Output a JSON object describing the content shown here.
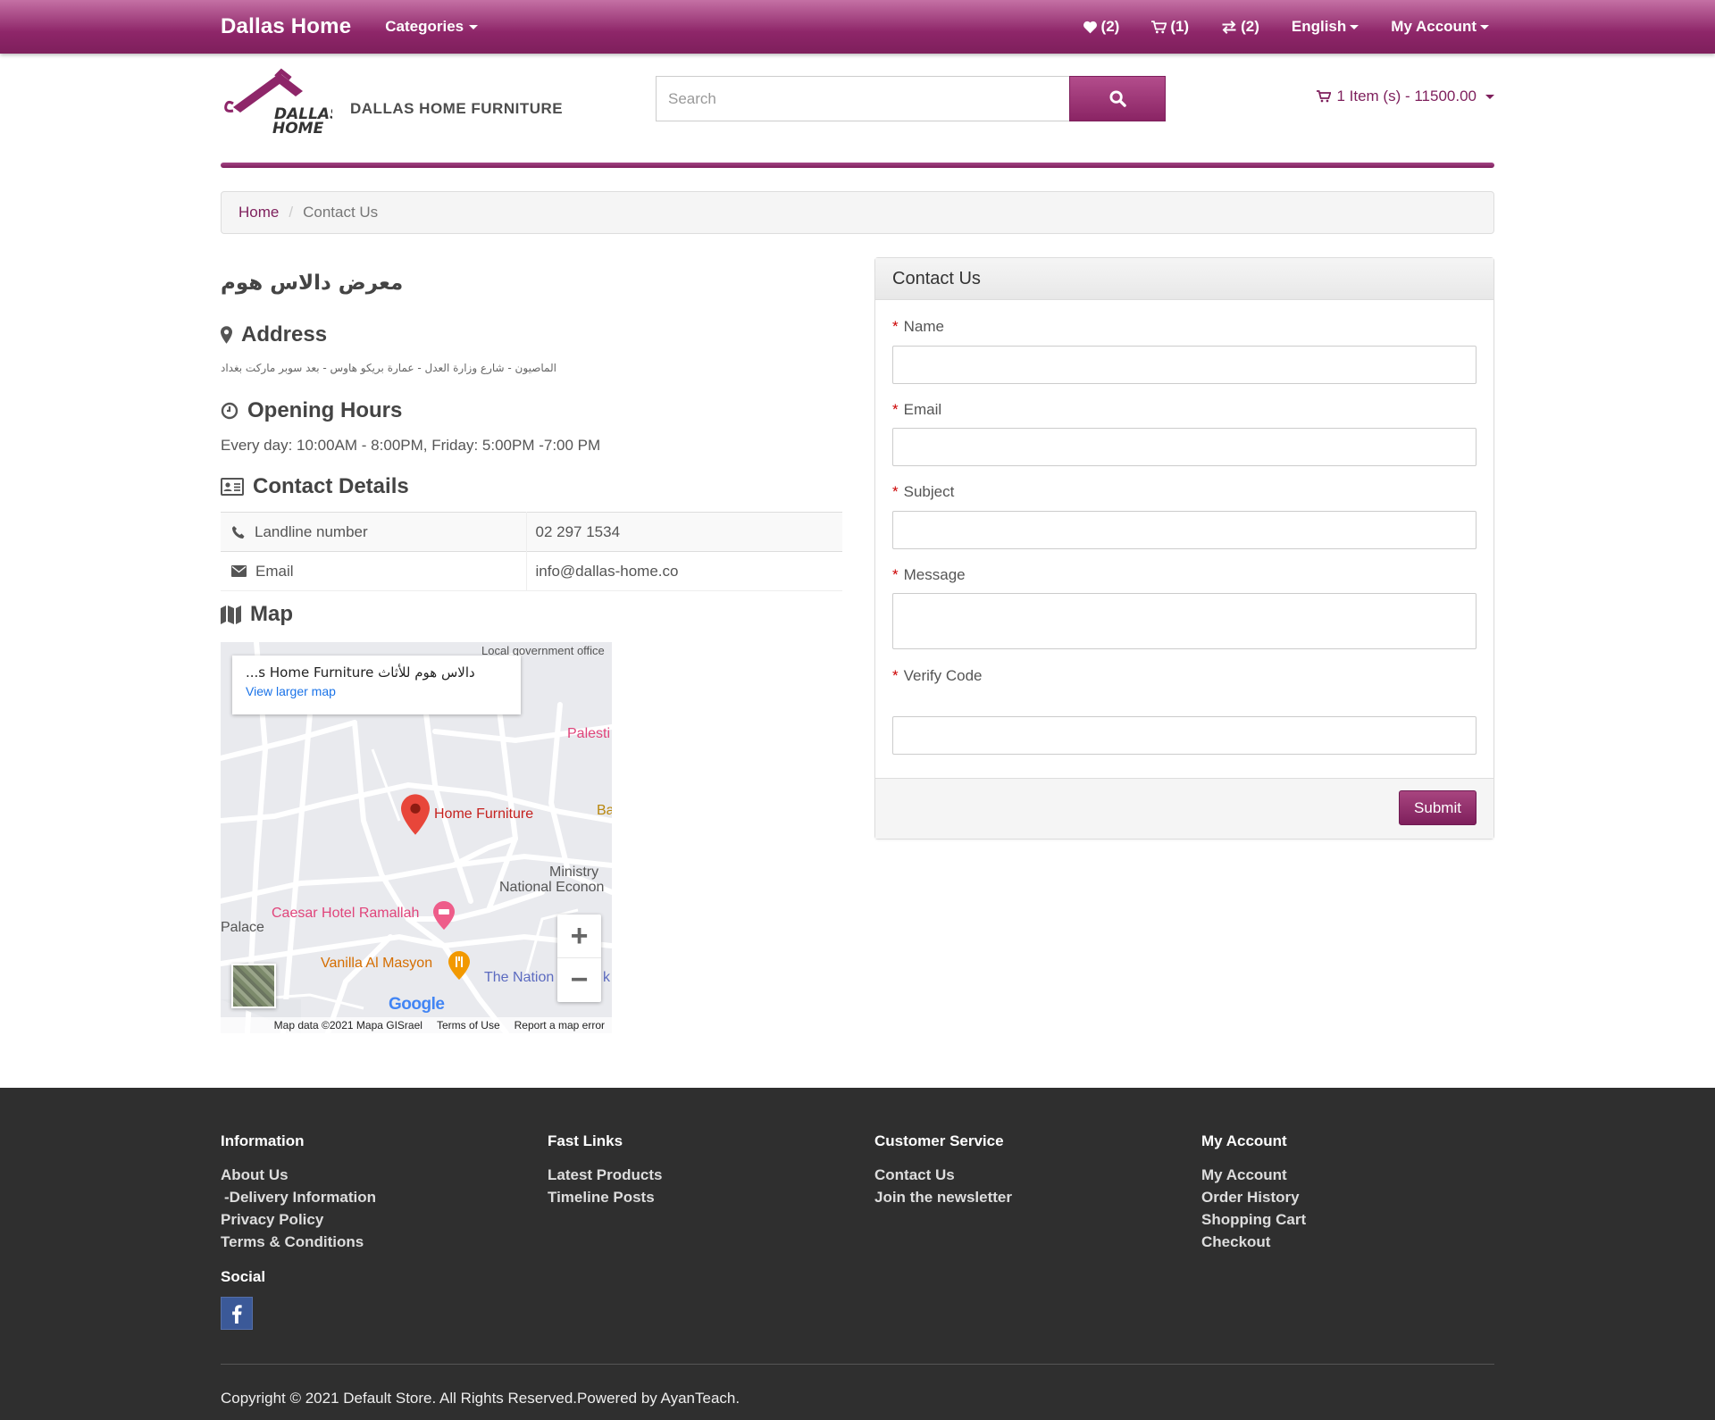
{
  "topbar": {
    "brand": "Dallas Home",
    "categories": "Categories",
    "wishlist": "(2)",
    "cart": "(1)",
    "compare": "(2)",
    "language": "English",
    "account": "My Account"
  },
  "header": {
    "logo_text_1": "DALLAS",
    "logo_text_2": "HOME",
    "store_name": "DALLAS HOME FURNITURE",
    "search_placeholder": "Search",
    "cart_summary": "1 Item (s) - 11500.00"
  },
  "breadcrumb": {
    "home": "Home",
    "current": "Contact Us"
  },
  "info": {
    "shop_title": "معرض دالاس هوم",
    "address_heading": "Address",
    "address": "الماصيون - شارع وزارة العدل - عمارة بريكو هاوس - بعد سوبر ماركت بغداد",
    "hours_heading": "Opening Hours",
    "hours": "Every day: 10:00AM - 8:00PM, Friday: 5:00PM -7:00 PM",
    "contact_heading": "Contact Details",
    "rows": [
      {
        "label": "Landline number",
        "value": "02 297 1534",
        "icon": "phone-icon"
      },
      {
        "label": "Email",
        "value": "info@dallas-home.co",
        "icon": "envelope-icon"
      }
    ],
    "map_heading": "Map"
  },
  "map": {
    "card_title": "...s Home Furniture دالاس هوم للأثاث",
    "card_link": "View larger map",
    "labels": {
      "gov": "Local government office",
      "palest": "Palesti",
      "home": "Home Furniture",
      "ba": "Ba",
      "ministry_1": "Ministry",
      "ministry_2": "National Econon",
      "caesar": "Caesar Hotel Ramallah",
      "palace": "Palace",
      "vanilla": "Vanilla Al Masyon",
      "nation": "The Nation",
      "nation_2": "k"
    },
    "google": "Google",
    "attr_data": "Map data ©2021 Mapa GISrael",
    "attr_terms": "Terms of Use",
    "attr_report": "Report a map error"
  },
  "form": {
    "title": "Contact Us",
    "name": "Name",
    "email": "Email",
    "subject": "Subject",
    "message": "Message",
    "verify": "Verify Code",
    "submit": "Submit"
  },
  "footer": {
    "info_title": "Information",
    "info_links": [
      "About Us",
      "-Delivery Information",
      "Privacy Policy",
      "Terms & Conditions"
    ],
    "fast_title": "Fast Links",
    "fast_links": [
      "Latest Products",
      "Timeline Posts"
    ],
    "cs_title": "Customer Service",
    "cs_links": [
      "Contact Us",
      "Join the newsletter"
    ],
    "acc_title": "My Account",
    "acc_links": [
      "My Account",
      "Order History",
      "Shopping Cart",
      "Checkout"
    ],
    "social_title": "Social",
    "copyright": "Copyright © 2021 Default Store. All Rights Reserved.Powered by AyanTeach."
  },
  "colors": {
    "brand": "#7e1f5c",
    "footer": "#2f2f2f"
  }
}
